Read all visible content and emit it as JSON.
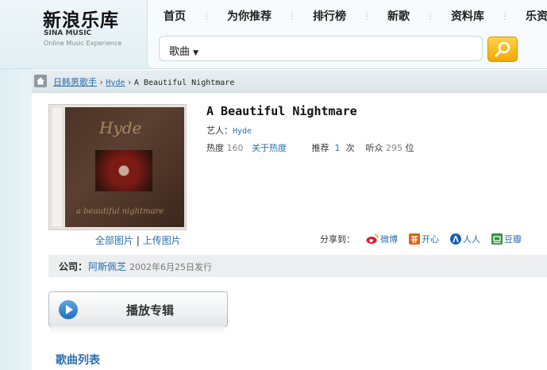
{
  "logo": {
    "cn": "新浪乐库",
    "en1": "SINA MUSIC",
    "en2": "Online Music Experience"
  },
  "nav": {
    "items": [
      {
        "label": "首页"
      },
      {
        "label": "为你推荐"
      },
      {
        "label": "排行榜"
      },
      {
        "label": "新歌"
      },
      {
        "label": "资料库"
      },
      {
        "label": "乐资讯"
      }
    ]
  },
  "search": {
    "type_label": "歌曲",
    "type_arrow": "▼",
    "value": "",
    "placeholder": ""
  },
  "breadcrumb": {
    "category": "日韩男歌手",
    "artist": "Hyde",
    "album": "A Beautiful Nightmare",
    "sep": "›"
  },
  "album": {
    "title": "A Beautiful Nightmare",
    "artist_label": "艺人：",
    "artist": "Hyde",
    "cover_text_top": "Hyde",
    "cover_text_bottom": "a beautiful nightmare",
    "heat_label": "热度",
    "heat_value": "160",
    "about_heat": "关于热度",
    "recommend_label": "推荐",
    "recommend_value": "1",
    "recommend_unit": "次",
    "listeners_label": "听众",
    "listeners_value": "295",
    "listeners_unit": "位"
  },
  "cover_links": {
    "all_images": "全部图片",
    "sep": "|",
    "upload_image": "上传图片"
  },
  "share": {
    "label": "分享到：",
    "targets": [
      {
        "label": "微博",
        "icon": "weibo-icon",
        "color": "#e6162d"
      },
      {
        "label": "开心",
        "icon": "kaixin-icon",
        "color": "#e8600e"
      },
      {
        "label": "人人",
        "icon": "renren-icon",
        "color": "#1b5da8"
      },
      {
        "label": "豆瓣",
        "icon": "douban-icon",
        "color": "#2e963d"
      }
    ]
  },
  "company": {
    "label": "公司：",
    "name": "阿斯佩芝",
    "release": "2002年6月25日发行"
  },
  "play_button": {
    "label": "播放专辑",
    "icon": "play-icon"
  },
  "song_list": {
    "heading": "歌曲列表"
  },
  "colors": {
    "link": "#2a6fb0",
    "search_button": "#f3a800"
  }
}
